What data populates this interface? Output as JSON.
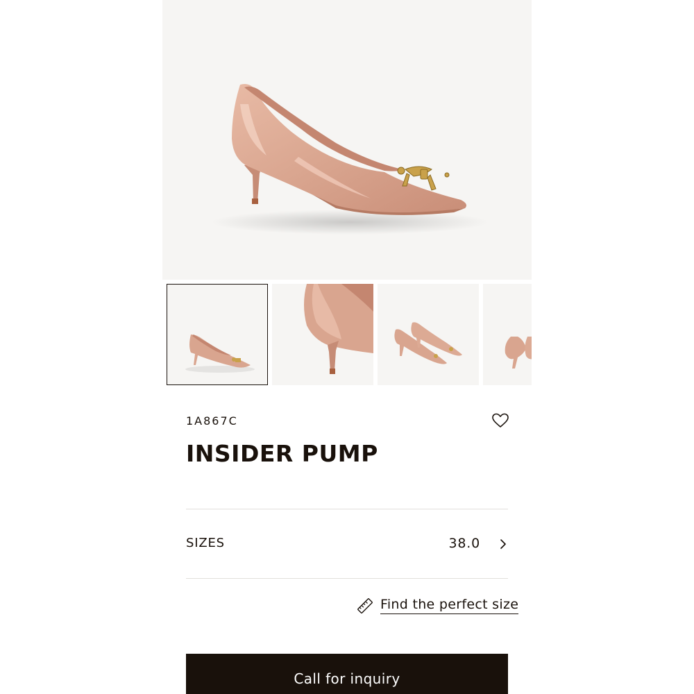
{
  "product": {
    "sku": "1A867C",
    "name": "INSIDER PUMP",
    "colors": {
      "shoe": "#d9a58f",
      "hardware": "#c9a14a",
      "image_background": "#f6f5f3"
    }
  },
  "gallery": {
    "main_image": "pump-side-view",
    "thumbnails": [
      {
        "name": "pump-side-view",
        "selected": true
      },
      {
        "name": "heel-closeup",
        "selected": false
      },
      {
        "name": "pair-front-view",
        "selected": false
      },
      {
        "name": "pair-back-view",
        "selected": false
      }
    ]
  },
  "sizes": {
    "label": "SIZES",
    "value": "38.0",
    "chevron": "chevron-right-icon"
  },
  "find_size": {
    "icon": "ruler-icon",
    "label": "Find the perfect size"
  },
  "wishlist": {
    "icon": "heart-icon"
  },
  "cta": {
    "label": "Call for inquiry",
    "color": "#19110b"
  }
}
